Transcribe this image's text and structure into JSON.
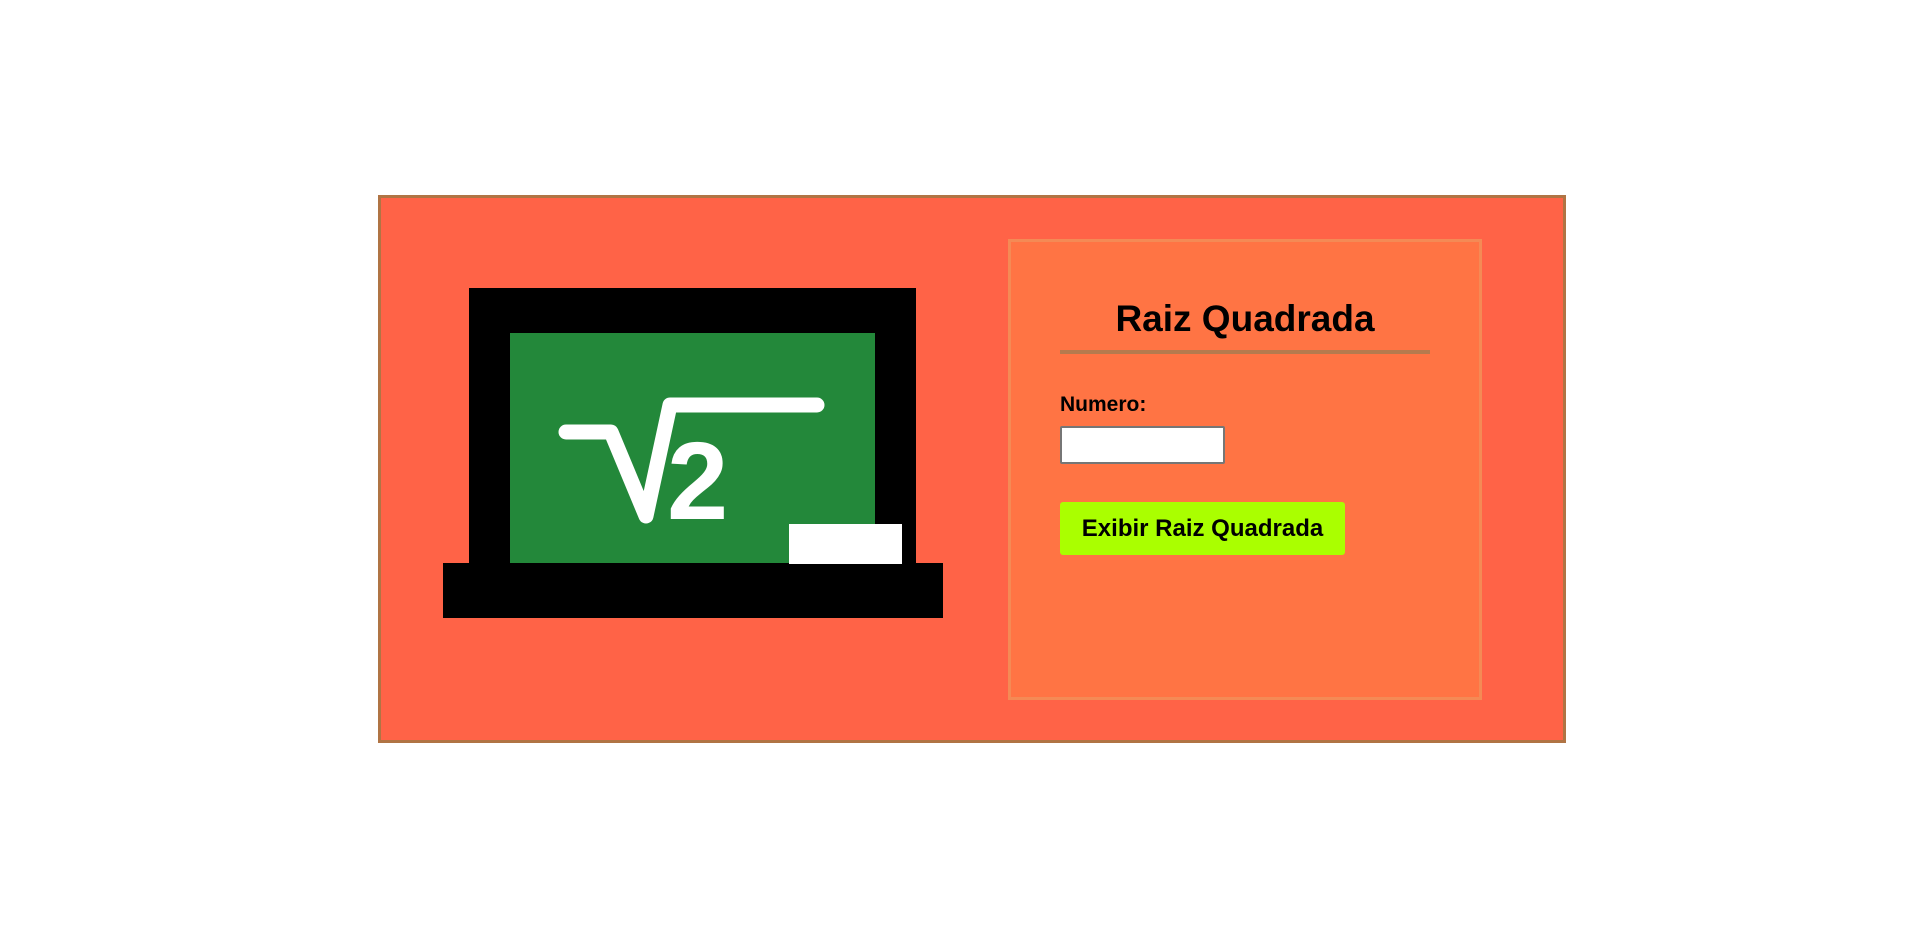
{
  "colors": {
    "page_background": "#ffffff",
    "card_background": "#ff6347",
    "card_border": "#b07444",
    "panel_background": "#ff7444",
    "chalkboard": "#23883a",
    "frame": "#000000",
    "button_background": "#aaff00"
  },
  "illustration": {
    "icon": "laptop-chalkboard-square-root-icon",
    "board_text": "√2"
  },
  "form": {
    "title": "Raiz Quadrada",
    "number_label": "Numero:",
    "number_value": "",
    "number_placeholder": "",
    "submit_label": "Exibir Raiz Quadrada"
  }
}
